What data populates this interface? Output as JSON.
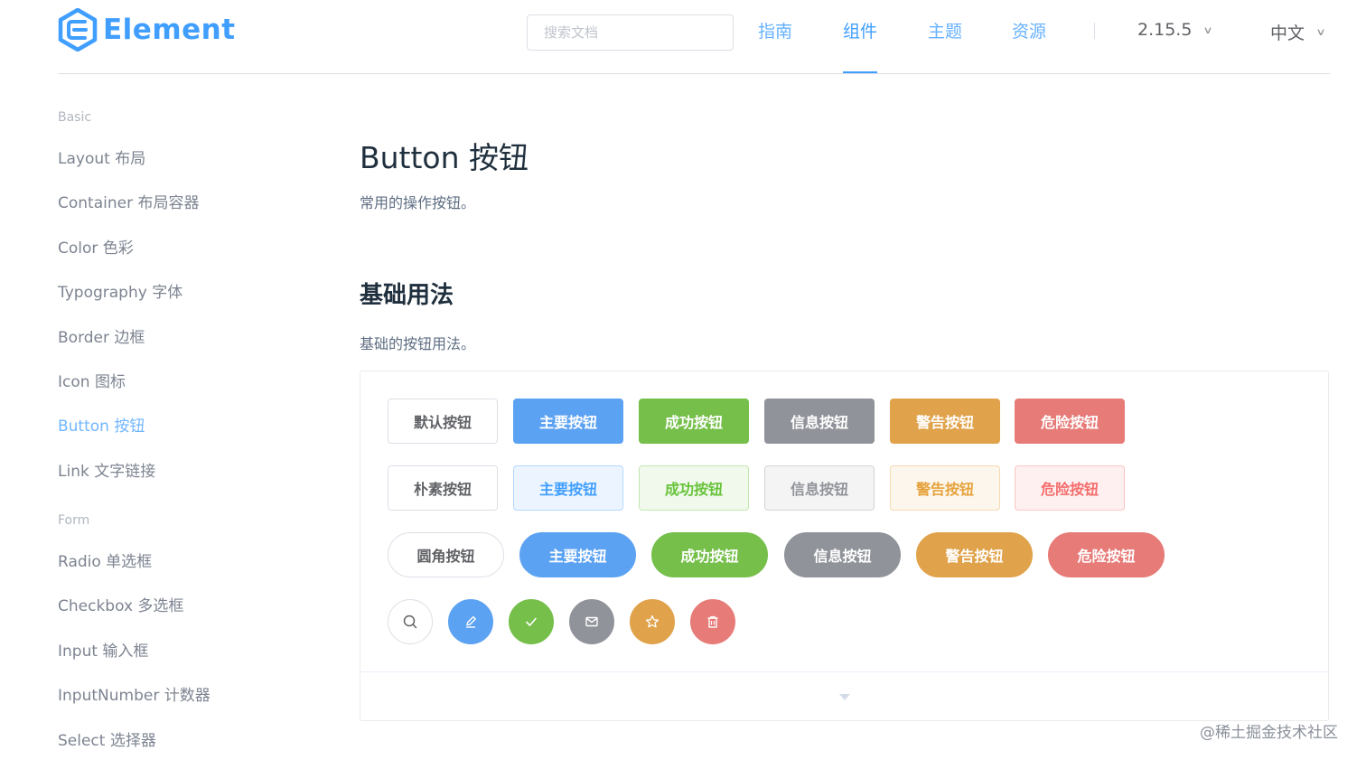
{
  "header": {
    "logo_text": "Element",
    "search_placeholder": "搜索文档",
    "nav": [
      "指南",
      "组件",
      "主题",
      "资源"
    ],
    "active_nav": "组件",
    "version": "2.15.5",
    "language": "中文"
  },
  "sidebar": {
    "groups": [
      {
        "title": "Basic",
        "items": [
          "Layout 布局",
          "Container 布局容器",
          "Color 色彩",
          "Typography 字体",
          "Border 边框",
          "Icon 图标",
          "Button 按钮",
          "Link 文字链接"
        ]
      },
      {
        "title": "Form",
        "items": [
          "Radio 单选框",
          "Checkbox 多选框",
          "Input 输入框",
          "InputNumber 计数器",
          "Select 选择器"
        ]
      }
    ],
    "active_item": "Button 按钮"
  },
  "main": {
    "title": "Button 按钮",
    "description": "常用的操作按钮。",
    "section_title": "基础用法",
    "section_description": "基础的按钮用法。"
  },
  "demo": {
    "row1": [
      "默认按钮",
      "主要按钮",
      "成功按钮",
      "信息按钮",
      "警告按钮",
      "危险按钮"
    ],
    "row2": [
      "朴素按钮",
      "主要按钮",
      "成功按钮",
      "信息按钮",
      "警告按钮",
      "危险按钮"
    ],
    "row3": [
      "圆角按钮",
      "主要按钮",
      "成功按钮",
      "信息按钮",
      "警告按钮",
      "危险按钮"
    ],
    "circle_icons": [
      "search-icon",
      "edit-icon",
      "check-icon",
      "message-icon",
      "star-icon",
      "delete-icon"
    ]
  },
  "colors": {
    "primary": "#409eff",
    "success": "#67c23a",
    "info": "#909399",
    "warning": "#e6a23c",
    "danger": "#f56c6c"
  },
  "watermark": "@稀土掘金技术社区"
}
